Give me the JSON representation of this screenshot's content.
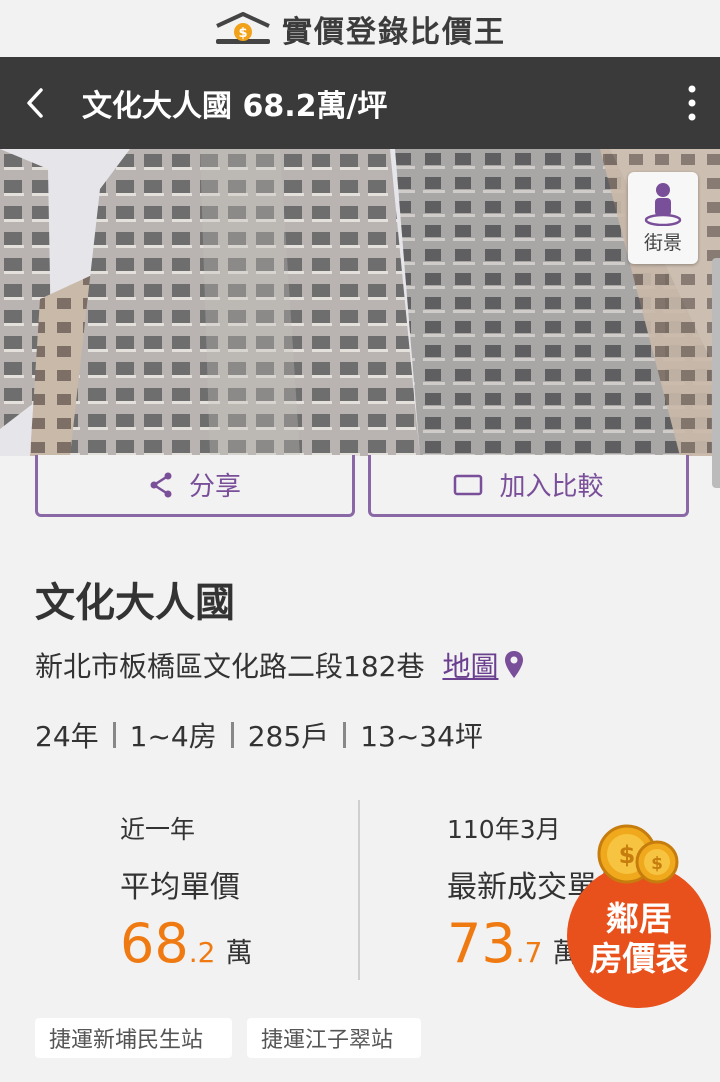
{
  "brand": {
    "name": "實價登錄比價王",
    "logo_symbol": "$"
  },
  "appbar": {
    "title": "文化大人國 68.2萬/坪"
  },
  "streetview": {
    "label": "街景"
  },
  "actions": {
    "share_label": "分享",
    "compare_label": "加入比較"
  },
  "property": {
    "name": "文化大人國",
    "address": "新北市板橋區文化路二段182巷",
    "map_link": "地圖",
    "specs": [
      "24年",
      "1~4房",
      "285戶",
      "13~34坪"
    ]
  },
  "stats": {
    "avg": {
      "period": "近一年",
      "label": "平均單價",
      "value_int": "68",
      "value_dec": ".2",
      "unit": "萬"
    },
    "latest": {
      "period": "110年3月",
      "label": "最新成交單價",
      "value_int": "73",
      "value_dec": ".7",
      "unit": "萬"
    }
  },
  "badge": {
    "line1": "鄰居",
    "line2": "房價表",
    "coin_symbol": "$"
  },
  "stations": [
    "捷運新埔民生站",
    "捷運江子翠站"
  ],
  "colors": {
    "accent": "#7a4f99",
    "price": "#f07a12",
    "appbar": "#3a3a3a",
    "badge": "#e9511c"
  }
}
